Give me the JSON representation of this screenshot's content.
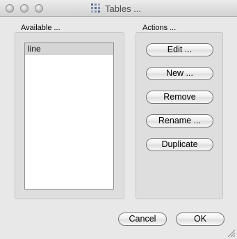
{
  "window": {
    "title": "Tables ...",
    "icons": {
      "app": "table-grid-icon",
      "resize": "resize-grip-icon"
    }
  },
  "available": {
    "label": "Available ...",
    "items": [
      "line"
    ]
  },
  "actions": {
    "label": "Actions ...",
    "edit": "Edit ...",
    "new": "New ...",
    "remove": "Remove",
    "rename": "Rename ...",
    "duplicate": "Duplicate"
  },
  "footer": {
    "cancel": "Cancel",
    "ok": "OK"
  }
}
